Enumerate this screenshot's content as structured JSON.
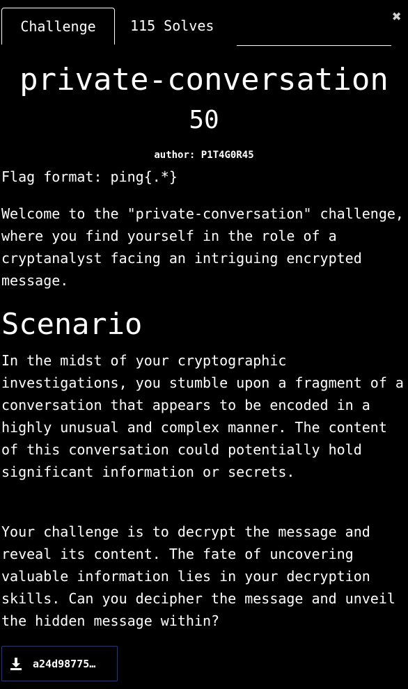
{
  "tabs": [
    {
      "label": "Challenge"
    },
    {
      "label": "115 Solves"
    }
  ],
  "close_icon": "close-icon",
  "challenge": {
    "title": "private-conversation",
    "points": "50",
    "author": "author: P1T4G0R45",
    "flag_format": "Flag format: ping{.*}",
    "intro": "Welcome to the \"private-conversation\" challenge, where you find yourself in the role of a cryptanalyst facing an intriguing encrypted message.",
    "scenario_heading": "Scenario",
    "scenario_text": "In the midst of your cryptographic investigations, you stumble upon a fragment of a conversation that appears to be encoded in a highly unusual and complex manner. The content of this conversation could potentially hold significant information or secrets.",
    "task_text": "Your challenge is to decrypt the message and reveal its content. The fate of uncovering valuable information lies in your decryption skills. Can you decipher the message and unveil the hidden message within?"
  },
  "file": {
    "label": "a24d98775…",
    "icon": "download-icon"
  },
  "colors": {
    "background": "#000000",
    "text": "#ffffff",
    "download_border": "#2a3a6b"
  }
}
